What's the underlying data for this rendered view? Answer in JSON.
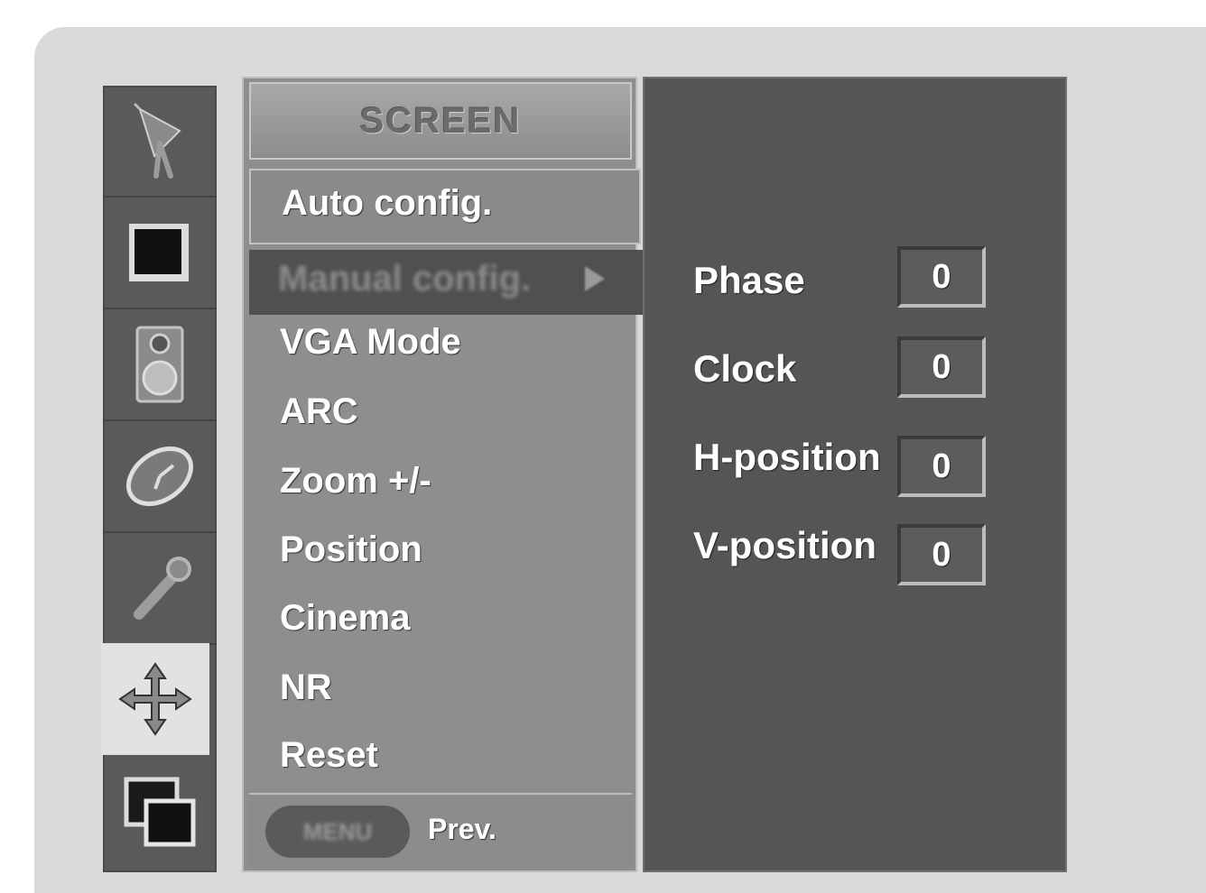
{
  "icons": [
    {
      "name": "satellite-dish-icon"
    },
    {
      "name": "picture-square-icon"
    },
    {
      "name": "speaker-icon"
    },
    {
      "name": "clock-time-icon"
    },
    {
      "name": "wrench-icon"
    },
    {
      "name": "move-arrows-icon",
      "active": true
    },
    {
      "name": "pip-windows-icon"
    }
  ],
  "menu": {
    "title": "SCREEN",
    "items": [
      {
        "label": "Auto config."
      },
      {
        "label": "Manual config.",
        "selected": true
      },
      {
        "label": "VGA Mode"
      },
      {
        "label": "ARC"
      },
      {
        "label": "Zoom +/-"
      },
      {
        "label": "Position"
      },
      {
        "label": "Cinema"
      },
      {
        "label": "NR"
      },
      {
        "label": "Reset"
      }
    ],
    "footer": {
      "button_label": "MENU",
      "prev_label": "Prev."
    }
  },
  "manual_config": {
    "params": [
      {
        "label": "Phase",
        "value": "0"
      },
      {
        "label": "Clock",
        "value": "0"
      },
      {
        "label": "H-position",
        "value": "0"
      },
      {
        "label": "V-position",
        "value": "0"
      }
    ]
  }
}
